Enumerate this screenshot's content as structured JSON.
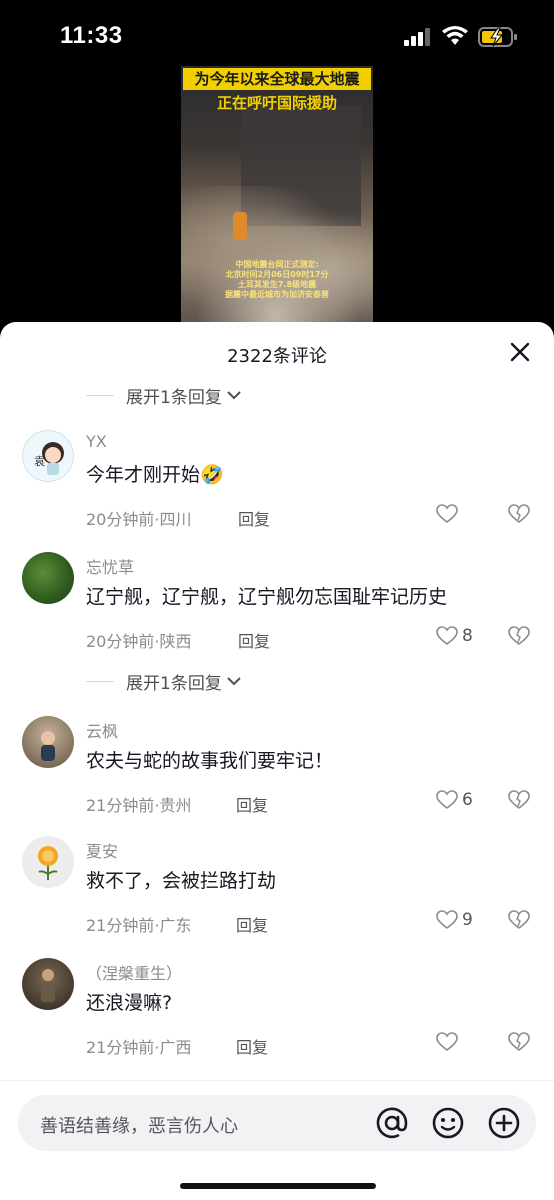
{
  "status_bar": {
    "time": "11:33"
  },
  "video": {
    "title_line1": "为今年以来全球最大地震",
    "title_line2": "正在呼吁国际援助",
    "info_lines": [
      "中国地震台网正式测定:",
      "北京时间2月06日09时17分",
      "土耳其发生7.8级地震",
      "据震中最近城市为加济安泰普"
    ]
  },
  "sheet": {
    "title": "2322条评论",
    "expand_label": "展开1条回复"
  },
  "comments": [
    {
      "user": "YX",
      "text": "今年才刚开始🤣",
      "time": "20分钟前",
      "region": "四川",
      "reply": "回复",
      "likes": ""
    },
    {
      "user": "忘忧草",
      "text": "辽宁舰，辽宁舰，辽宁舰勿忘国耻牢记历史",
      "time": "20分钟前",
      "region": "陕西",
      "reply": "回复",
      "likes": "8"
    },
    {
      "user": "云枫",
      "text": "农夫与蛇的故事我们要牢记！",
      "time": "21分钟前",
      "region": "贵州",
      "reply": "回复",
      "likes": "6"
    },
    {
      "user": "夏安",
      "text": "救不了，会被拦路打劫",
      "time": "21分钟前",
      "region": "广东",
      "reply": "回复",
      "likes": "9"
    },
    {
      "user": "（涅槃重生）",
      "text": "还浪漫嘛?",
      "time": "21分钟前",
      "region": "广西",
      "reply": "回复",
      "likes": ""
    }
  ],
  "input": {
    "placeholder": "善语结善缘，恶言伤人心"
  },
  "icons": {
    "close": "close-icon",
    "heart": "heart-icon",
    "dislike": "broken-heart-icon",
    "at": "at-icon",
    "emoji": "emoji-icon",
    "plus": "plus-icon"
  },
  "colors": {
    "video_title_bg": "#f2d000",
    "text_primary": "#161823",
    "text_secondary": "#8a8b91"
  }
}
